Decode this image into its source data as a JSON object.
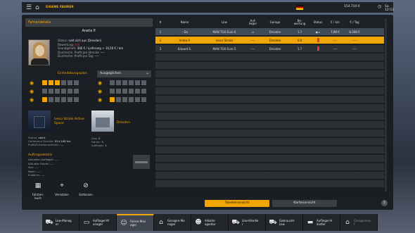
{
  "topbar": {
    "breadcrumb": "EIGENE FAHRER",
    "money": "154.710 €",
    "time": "Sa 12:53"
  },
  "panel": {
    "header": "Fahrerdetails",
    "driver_name": "Aneta P.",
    "status_label": "Status:",
    "status_value": "ruht sich aus (Dresden)",
    "rating_label": "Bewertung:",
    "rating_value": "0.8",
    "salary_label": "Grundgehalt:",
    "salary_value": "366 € / Lieferung + 10,50 € / km",
    "profit_route_label": "Durchschn. Profit pro Strecke:",
    "profit_route_value": "----",
    "profit_day_label": "Durchschn. Profit pro Tag:",
    "profit_day_value": "----",
    "skills_label": "Einheitsbungsplan:",
    "skills_dropdown": "Ausgeglichen",
    "truck_name": "Iveco Stralis Active Space",
    "garage_name": "Dresden",
    "truck_stats": {
      "status_label": "Status:",
      "status_value": "steht",
      "distance_label": "Gefahrene Strecke:",
      "distance_value": "914.188 km",
      "profit_label": "Profit/Schadenseinheit:",
      "profit_value": "----"
    },
    "garage_stats": {
      "lkw_label": "Lkw:",
      "lkw_value": "3",
      "drivers_label": "Fahrer:",
      "drivers_value": "3",
      "trailer_label": "Auflieger:",
      "trailer_value": "1"
    },
    "orders_title": "Auftragsdetails",
    "orders": {
      "trailer": "Aktueller Auflieger: ----",
      "cargo": "Aktuelle Fracht: ----",
      "from": "Von: ----",
      "to": "Nach: ----",
      "end": "Endet in: ----"
    },
    "actions": {
      "logbook": "Fahrten-\nbuch",
      "transfer": "Versetzen",
      "fire": "Entlassen"
    }
  },
  "table": {
    "headers": {
      "num": "#",
      "name": "Name",
      "lkw": "Lkw",
      "trailer": "Auf-\nlieger",
      "garage": "Garage",
      "rating": "Be-\nwertung",
      "status": "Status",
      "per_km": "€ / km",
      "per_day": "€ / Tag"
    },
    "rows": [
      {
        "num": "1",
        "name": "Du",
        "lkw": "MAN TGX Euro 6",
        "trailer": "▭",
        "garage": "Dresden",
        "rating": "1.7",
        "status": "◆▭",
        "per_km": "7,89 €",
        "per_day": "8.368 €"
      },
      {
        "num": "2",
        "name": "Aneta P.",
        "lkw": "Iveco Stralis",
        "trailer": "----",
        "garage": "Dresden",
        "rating": "0.8",
        "status": "",
        "per_km": "----",
        "per_day": "----"
      },
      {
        "num": "3",
        "name": "Eduard S.",
        "lkw": "MAN TGX Euro 5",
        "trailer": "----",
        "garage": "Dresden",
        "rating": "1.7",
        "status": "",
        "per_km": "----",
        "per_day": "----"
      }
    ],
    "tab_table": "Tabellenansicht",
    "tab_map": "Kartenansicht",
    "help": "?"
  },
  "nav": [
    {
      "label": "Lkw-Manag\ner",
      "icon": "truck-manager-icon"
    },
    {
      "label": "Auflieger-M\nanager",
      "icon": "trailer-manager-icon"
    },
    {
      "label": "Fahrer-Man\nager",
      "icon": "driver-manager-icon"
    },
    {
      "label": "Garagen-Ma\nnager",
      "icon": "garage-manager-icon"
    },
    {
      "label": "Arbeits-\nagentur",
      "icon": "job-agency-icon"
    },
    {
      "label": "Lkw-Händle\nr",
      "icon": "truck-dealer-icon"
    },
    {
      "label": "Gebraucht-\nLkw",
      "icon": "used-truck-icon"
    },
    {
      "label": "Auflieger-H\nändler",
      "icon": "trailer-dealer-icon"
    },
    {
      "label": "Garagenkau\nf",
      "icon": "garage-buy-icon"
    }
  ],
  "colors": {
    "accent": "#f0a500",
    "alert": "#e53935"
  }
}
